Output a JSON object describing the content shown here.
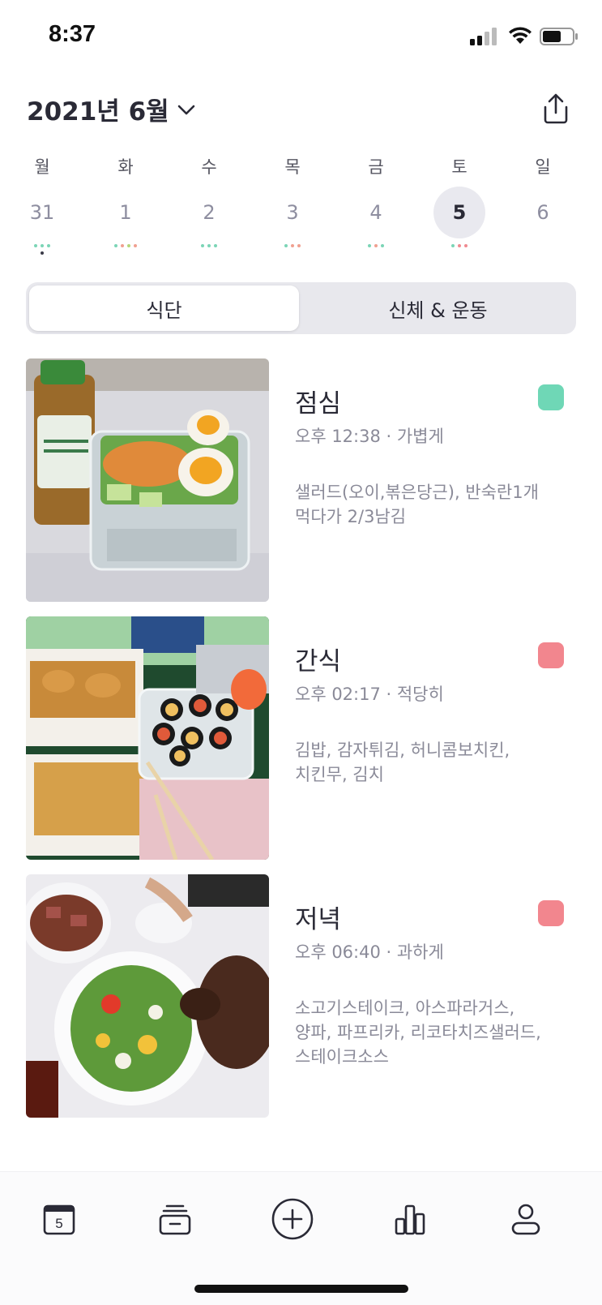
{
  "status_bar": {
    "time": "8:37"
  },
  "header": {
    "month_title": "2021년 6월"
  },
  "week": [
    {
      "name": "월",
      "date": "31",
      "selected": false,
      "dots": [
        "#7bd5b6",
        "#7bd5b6",
        "#7bd5b6"
      ]
    },
    {
      "name": "화",
      "date": "1",
      "selected": false,
      "dots": [
        "#7bd5b6",
        "#f0a090",
        "#b6d77a",
        "#f0a090"
      ]
    },
    {
      "name": "수",
      "date": "2",
      "selected": false,
      "dots": [
        "#7bd5b6",
        "#7bd5b6",
        "#7bd5b6"
      ]
    },
    {
      "name": "목",
      "date": "3",
      "selected": false,
      "dots": [
        "#7bd5b6",
        "#f0a090",
        "#f0a090"
      ]
    },
    {
      "name": "금",
      "date": "4",
      "selected": false,
      "dots": [
        "#7bd5b6",
        "#f0a090",
        "#7bd5b6"
      ]
    },
    {
      "name": "토",
      "date": "5",
      "selected": true,
      "dots": [
        "#7bd5b6",
        "#f08a90",
        "#f08a90"
      ]
    },
    {
      "name": "일",
      "date": "6",
      "selected": false,
      "dots": []
    }
  ],
  "segment": {
    "left_label": "식단",
    "right_label": "신체 & 운동",
    "active": "left"
  },
  "meals": [
    {
      "title": "점심",
      "time_text": "오후 12:38 · 가볍게",
      "description": "샐러드(오이,볶은당근), 반숙란1개\n먹다가 2/3남김",
      "badge_color": "#6fd7b6",
      "photo_icon": "salad-photo"
    },
    {
      "title": "간식",
      "time_text": "오후 02:17 · 적당히",
      "description": "김밥, 감자튀김, 허니콤보치킨,\n치킨무, 김치",
      "badge_color": "#f2868e",
      "photo_icon": "kimbap-chicken-photo"
    },
    {
      "title": "저녁",
      "time_text": "오후 06:40 · 과하게",
      "description": "소고기스테이크, 아스파라거스,\n양파, 파프리카, 리코타치즈샐러드,\n스테이크소스",
      "badge_color": "#f2868e",
      "photo_icon": "steak-salad-photo"
    }
  ],
  "tab_bar": {
    "calendar_day": "5",
    "icons": [
      "calendar-icon",
      "archive-icon",
      "add-circle-icon",
      "bar-chart-icon",
      "profile-icon"
    ]
  },
  "colors": {
    "accent_green": "#6fd7b6",
    "accent_red": "#f2868e",
    "text_primary": "#2a2a36",
    "text_secondary": "#8a8a98",
    "segment_bg": "#e8e8ed"
  }
}
